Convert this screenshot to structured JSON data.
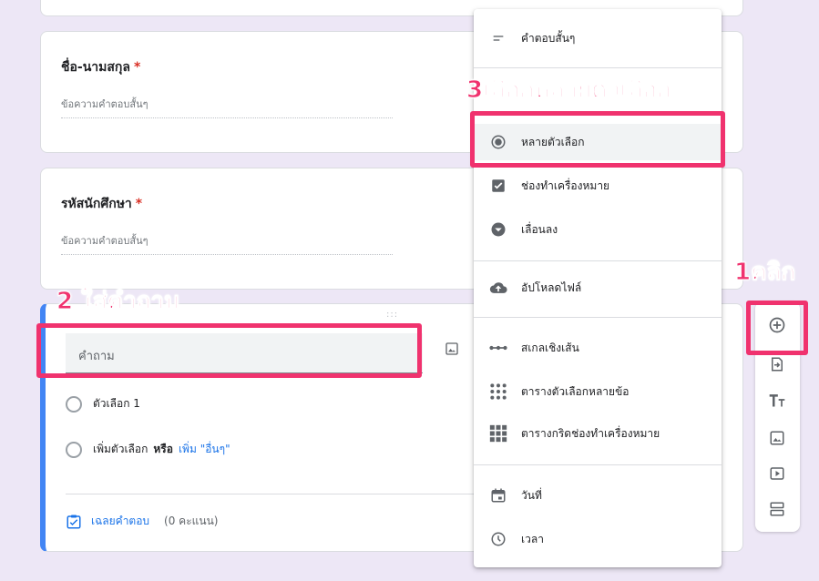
{
  "form": {
    "q1": {
      "title": "ชื่อ-นามสกุล",
      "required_mark": "*",
      "answer_placeholder": "ข้อความคำตอบสั้นๆ"
    },
    "q2": {
      "title": "รหัสนักศึกษา",
      "required_mark": "*",
      "answer_placeholder": "ข้อความคำตอบสั้นๆ"
    },
    "edit": {
      "drag_handle": ":::",
      "question_placeholder": "คำถาม",
      "option1": "ตัวเลือก 1",
      "add_option": "เพิ่มตัวเลือก",
      "or": "หรือ",
      "add_other": "เพิ่ม \"อื่นๆ\"",
      "answer_key": "เฉลยคำตอบ",
      "points": "(0 คะแนน)"
    }
  },
  "menu": {
    "items": [
      {
        "label": "คำตอบสั้นๆ",
        "icon": "short-answer-icon"
      },
      {
        "label": "หลายตัวเลือก",
        "icon": "radio-icon",
        "selected": true
      },
      {
        "label": "ช่องทำเครื่องหมาย",
        "icon": "checkbox-icon"
      },
      {
        "label": "เลื่อนลง",
        "icon": "dropdown-icon"
      },
      {
        "label": "อัปโหลดไฟล์",
        "icon": "cloud-upload-icon"
      },
      {
        "label": "สเกลเชิงเส้น",
        "icon": "linear-scale-icon"
      },
      {
        "label": "ตารางตัวเลือกหลายข้อ",
        "icon": "dot-grid-icon"
      },
      {
        "label": "ตารางกริดช่องทำเครื่องหมาย",
        "icon": "checkbox-grid-icon"
      },
      {
        "label": "วันที่",
        "icon": "calendar-icon"
      },
      {
        "label": "เวลา",
        "icon": "clock-icon"
      }
    ]
  },
  "toolbar": {
    "buttons": [
      "add-question-icon",
      "import-questions-icon",
      "title-text-icon",
      "image-icon",
      "video-icon",
      "section-icon"
    ]
  },
  "annotations": {
    "step1": "1คลิก",
    "step2": "2 ใส่คำถาม",
    "step3": "3เลือกหลายตัวเลือก"
  },
  "colors": {
    "accent": "#4285f4",
    "highlight": "#f0326e",
    "background": "#ede7f6",
    "link": "#1a73e8"
  }
}
